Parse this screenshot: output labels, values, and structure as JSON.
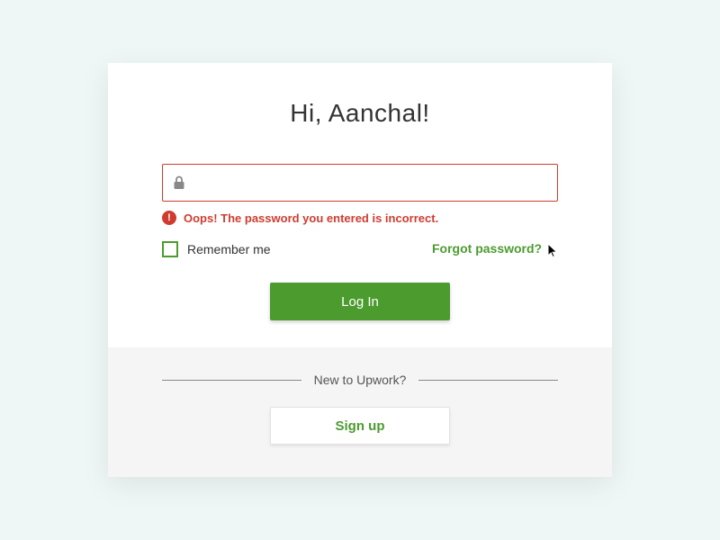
{
  "greeting": "Hi, Aanchal!",
  "password": {
    "value": "",
    "placeholder": ""
  },
  "error": {
    "message": "Oops! The password you entered is incorrect."
  },
  "remember": {
    "label": "Remember me",
    "checked": false
  },
  "forgot_label": "Forgot password?",
  "login_label": "Log In",
  "divider_label": "New to Upwork?",
  "signup_label": "Sign up",
  "colors": {
    "accent": "#4c9b2f",
    "error": "#cf3c2f"
  }
}
